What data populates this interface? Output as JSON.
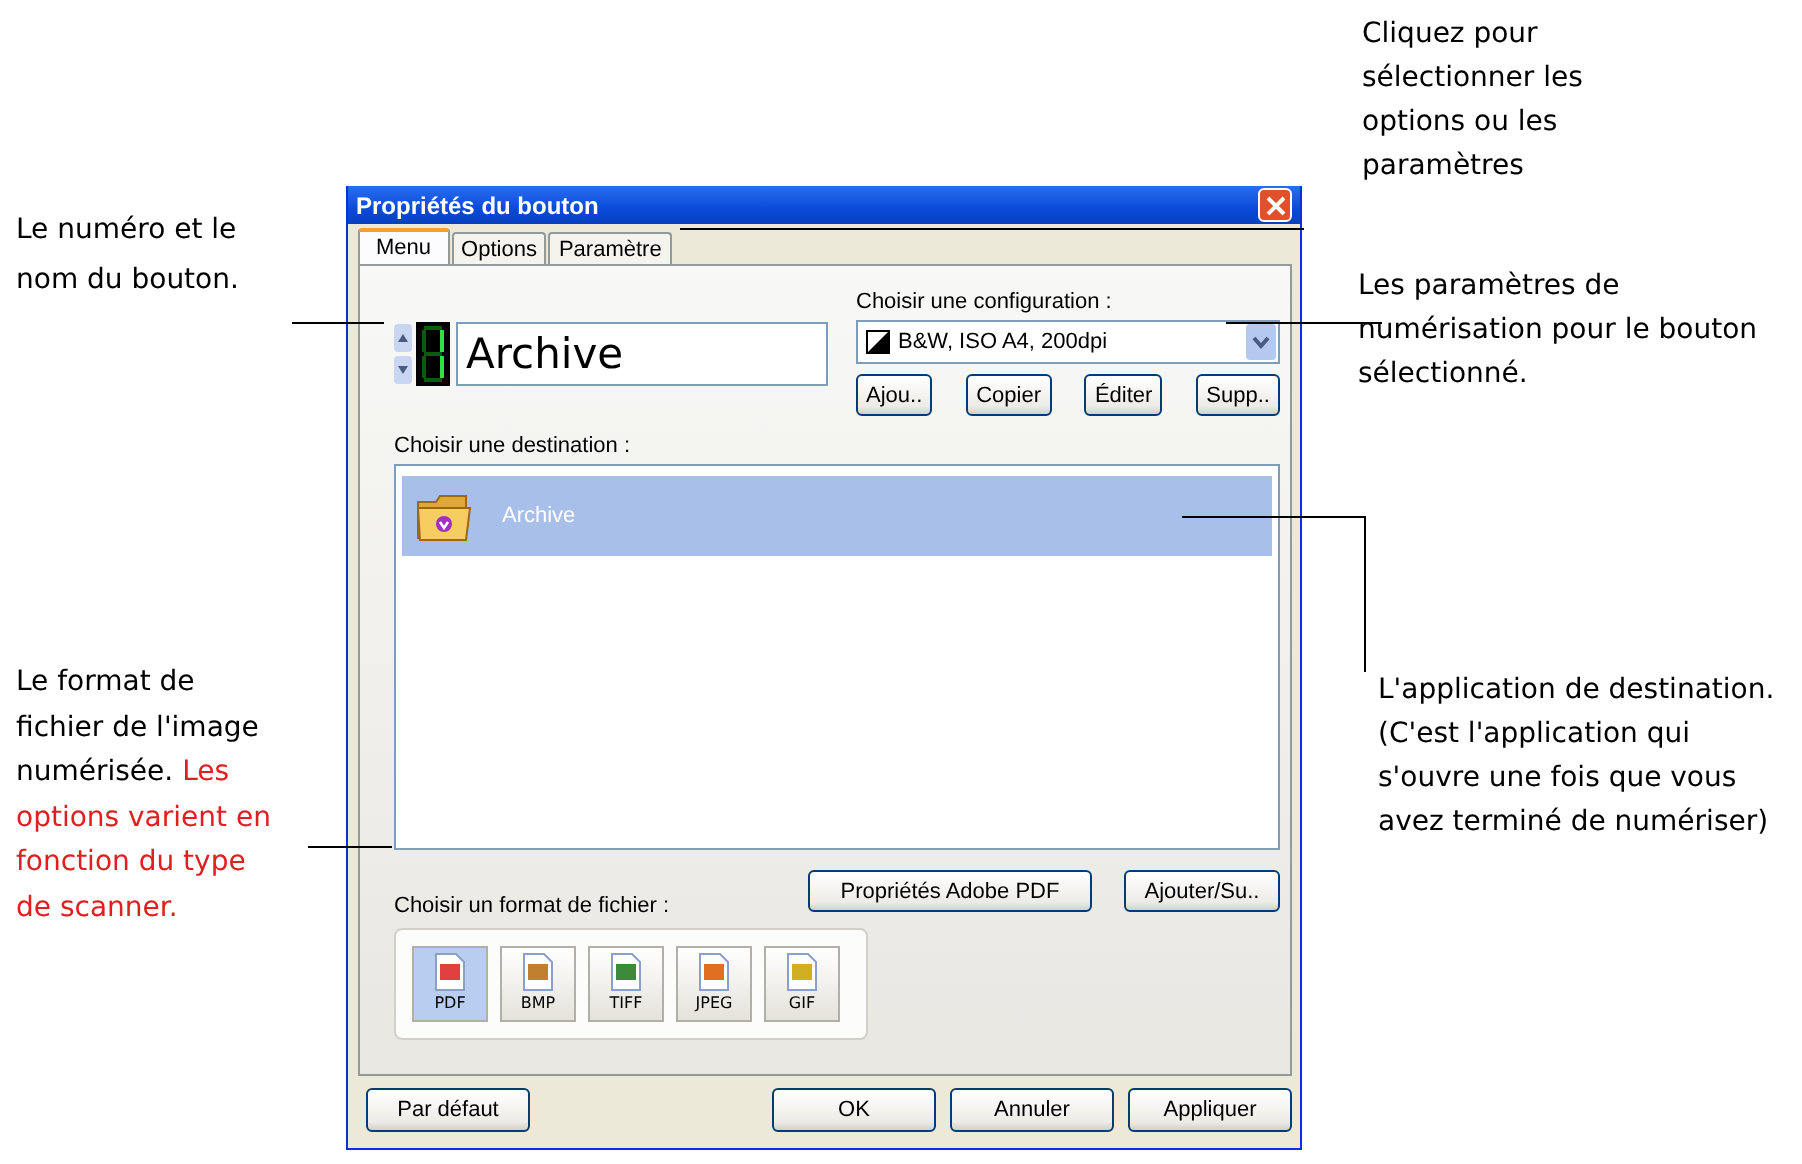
{
  "callouts_left": [
    {
      "text": "Le numéro et le nom du bouton."
    },
    {
      "text": "Le format de fichier de l'image numérisée.",
      "note": "Les options varient en fonction du type de scanner."
    }
  ],
  "callouts_right": [
    {
      "text": "Cliquez pour sélectionner les options ou les paramètres"
    },
    {
      "text": "Les paramètres de numérisation pour le bouton sélectionné."
    },
    {
      "text": "L'application de destination. (C'est l'application qui s'ouvre une fois que vous avez terminé de numériser)"
    }
  ],
  "window": {
    "title": "Propriétés du bouton"
  },
  "tabs": [
    {
      "label": "Menu",
      "selected": true
    },
    {
      "label": "Options",
      "selected": false
    },
    {
      "label": "Paramètre",
      "selected": false
    }
  ],
  "button_name": "Archive",
  "configuration": {
    "label": "Choisir une configuration :",
    "value": "B&W, ISO A4, 200dpi",
    "buttons": [
      "Ajou..",
      "Copier",
      "Éditer",
      "Supp.."
    ]
  },
  "destination": {
    "label": "Choisir une destination :",
    "items": [
      {
        "name": "Archive",
        "selected": true
      }
    ]
  },
  "file_format": {
    "label": "Choisir un format de fichier :",
    "buttons": [
      "Propriétés Adobe PDF",
      "Ajouter/Su.."
    ],
    "formats": [
      {
        "label": "PDF",
        "selected": true
      },
      {
        "label": "BMP",
        "selected": false
      },
      {
        "label": "TIFF",
        "selected": false
      },
      {
        "label": "JPEG",
        "selected": false
      },
      {
        "label": "GIF",
        "selected": false
      }
    ]
  },
  "footer_buttons": [
    "Par défaut",
    "OK",
    "Annuler",
    "Appliquer"
  ]
}
